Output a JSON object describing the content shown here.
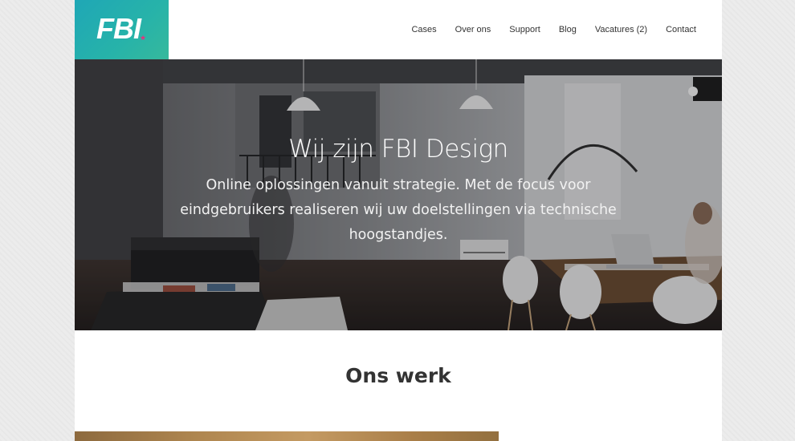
{
  "brand": {
    "logo_text": "FBI",
    "logo_star": "★",
    "colors": {
      "logo_teal": "#1fa7b6",
      "logo_green": "#36b99c",
      "star_pink": "#e5317d"
    }
  },
  "nav": {
    "items": [
      {
        "label": "Cases"
      },
      {
        "label": "Over ons"
      },
      {
        "label": "Support"
      },
      {
        "label": "Blog"
      },
      {
        "label": "Vacatures (2)"
      },
      {
        "label": "Contact"
      }
    ]
  },
  "hero": {
    "title": "Wij zijn FBI Design",
    "subtitle": "Online oplossingen vanuit strategie. Met de focus voor eindgebruikers realiseren wij uw doelstellingen via technische hoogstandjes."
  },
  "work": {
    "title": "Ons werk"
  }
}
